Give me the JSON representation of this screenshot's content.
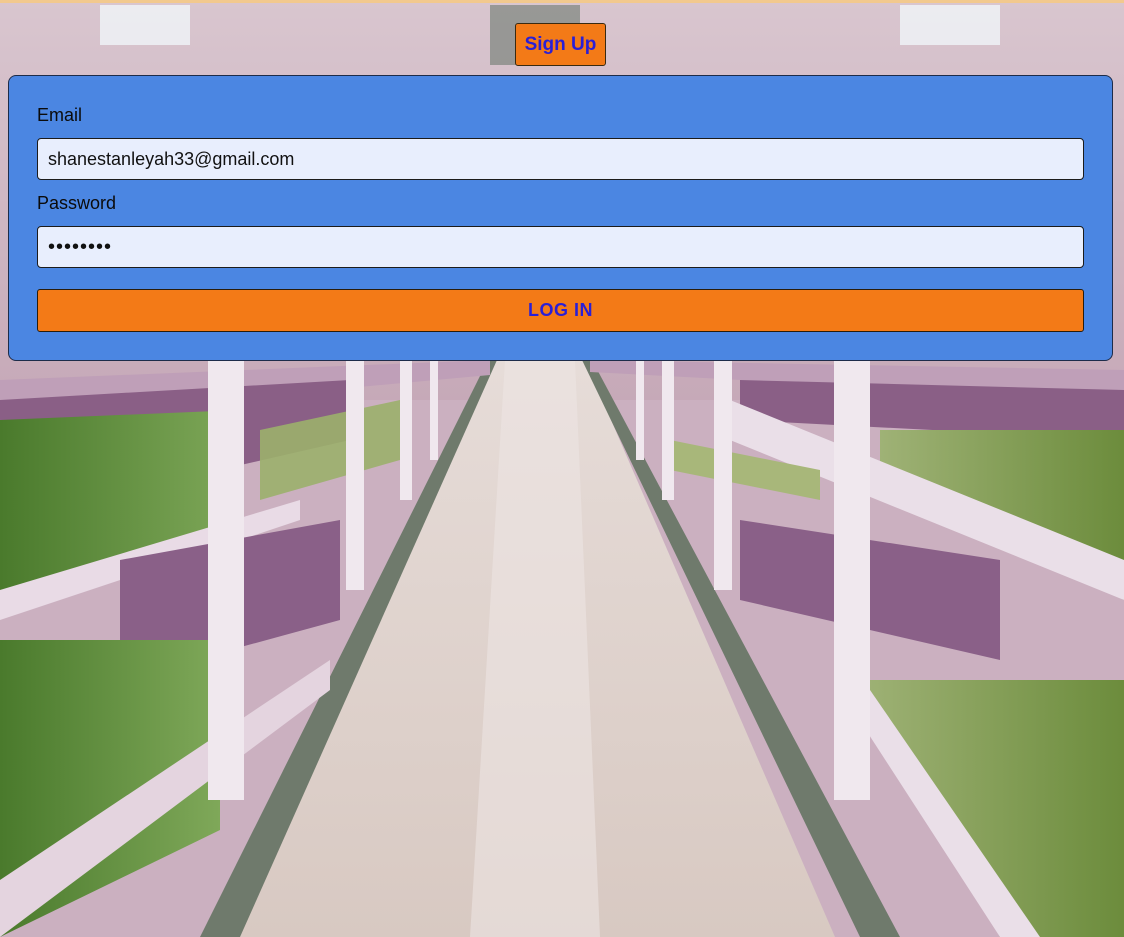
{
  "header": {
    "signup_label": "Sign Up"
  },
  "login": {
    "email_label": "Email",
    "email_value": "shanestanleyah33@gmail.com",
    "password_label": "Password",
    "password_value": "password",
    "submit_label": "LOG IN"
  },
  "background": {
    "subject": "vertical-farm-aisle-photo"
  },
  "colors": {
    "accent_orange": "#f37a17",
    "panel_blue": "#4b86e2",
    "button_text_blue": "#2a1fd6",
    "input_fill": "#e8eefd"
  }
}
